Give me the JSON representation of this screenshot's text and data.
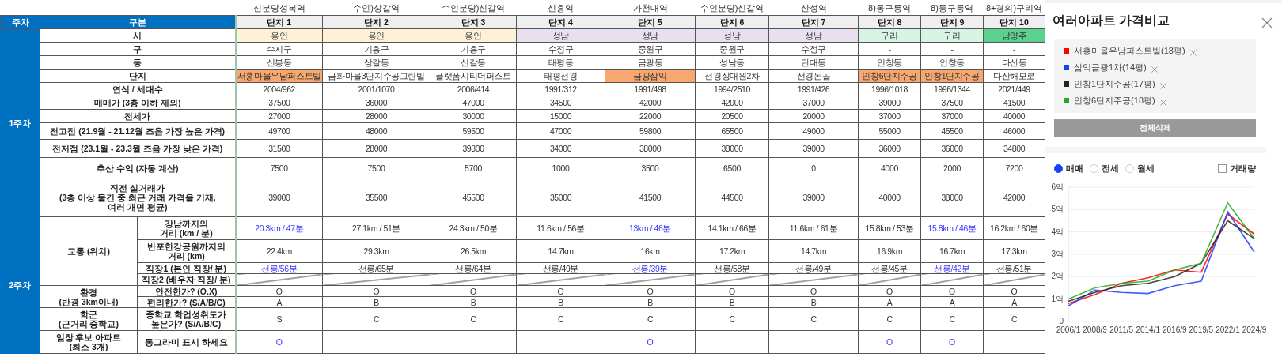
{
  "sheet": {
    "header": {
      "week": "주차",
      "category": "구분"
    },
    "complexes": [
      {
        "station": "신분당성복역",
        "name": "단지 1"
      },
      {
        "station": "수인)상갈역",
        "name": "단지 2"
      },
      {
        "station": "수인분당)신갈역",
        "name": "단지 3"
      },
      {
        "station": "신흥역",
        "name": "단지 4"
      },
      {
        "station": "가천대역",
        "name": "단지 5"
      },
      {
        "station": "수인분당)신갈역",
        "name": "단지 6"
      },
      {
        "station": "산성역",
        "name": "단지 7"
      },
      {
        "station": "8)동구릉역",
        "name": "단지 8"
      },
      {
        "station": "8)동구릉역",
        "name": "단지 9"
      },
      {
        "station": "8+경의)구리역",
        "name": "단지 10"
      }
    ],
    "weeks": [
      {
        "label": "1주차",
        "groups": [
          {
            "label": "시",
            "rows": [
              {
                "cells": [
                  {
                    "text": "용인",
                    "color": "#fdf2d7"
                  },
                  {
                    "text": "용인",
                    "color": "#fdf2d7"
                  },
                  {
                    "text": "용인",
                    "color": "#fdf2d7"
                  },
                  {
                    "text": "성남",
                    "color": "#e8e0f0"
                  },
                  {
                    "text": "성남",
                    "color": "#e8e0f0"
                  },
                  {
                    "text": "성남",
                    "color": "#e8e0f0"
                  },
                  {
                    "text": "성남",
                    "color": "#e8e0f0"
                  },
                  {
                    "text": "구리",
                    "color": "#d7f3e4"
                  },
                  {
                    "text": "구리",
                    "color": "#d7f3e4"
                  },
                  {
                    "text": "남양주",
                    "color": "#5ad18f"
                  }
                ]
              }
            ]
          },
          {
            "label": "구",
            "rows": [
              {
                "cells": [
                  {
                    "text": "수지구"
                  },
                  {
                    "text": "기흥구"
                  },
                  {
                    "text": "기흥구"
                  },
                  {
                    "text": "수정구"
                  },
                  {
                    "text": "중원구"
                  },
                  {
                    "text": "중원구"
                  },
                  {
                    "text": "수정구"
                  },
                  {
                    "text": "-"
                  },
                  {
                    "text": "-"
                  },
                  {
                    "text": "-"
                  }
                ]
              }
            ]
          },
          {
            "label": "동",
            "rows": [
              {
                "cells": [
                  {
                    "text": "신봉동"
                  },
                  {
                    "text": "상갈동"
                  },
                  {
                    "text": "신갈동"
                  },
                  {
                    "text": "태평동"
                  },
                  {
                    "text": "금광동"
                  },
                  {
                    "text": "성남동"
                  },
                  {
                    "text": "단대동"
                  },
                  {
                    "text": "인창동"
                  },
                  {
                    "text": "인창동"
                  },
                  {
                    "text": "다산동"
                  }
                ]
              }
            ]
          },
          {
            "label": "단지",
            "rows": [
              {
                "cells": [
                  {
                    "text": "서홍마을우남퍼스트빌",
                    "highlighted": true
                  },
                  {
                    "text": "금화마을3단지주공그린빌",
                    "highlighted": false
                  },
                  {
                    "text": "플랫폼시티더퍼스트",
                    "highlighted": false
                  },
                  {
                    "text": "태평선경",
                    "highlighted": false
                  },
                  {
                    "text": "금광삼익",
                    "highlighted": true
                  },
                  {
                    "text": "선경상대원2차",
                    "highlighted": false
                  },
                  {
                    "text": "선경논골",
                    "highlighted": false
                  },
                  {
                    "text": "인창6단지주공",
                    "highlighted": true
                  },
                  {
                    "text": "인창1단지주공",
                    "highlighted": true
                  },
                  {
                    "text": "다산해모로",
                    "highlighted": false
                  }
                ]
              }
            ]
          },
          {
            "label": "연식 / 세대수",
            "rows": [
              {
                "cells": [
                  {
                    "text": "2004/962"
                  },
                  {
                    "text": "2001/1070"
                  },
                  {
                    "text": "2006/414"
                  },
                  {
                    "text": "1991/312"
                  },
                  {
                    "text": "1991/498"
                  },
                  {
                    "text": "1994/2510"
                  },
                  {
                    "text": "1991/426"
                  },
                  {
                    "text": "1996/1018"
                  },
                  {
                    "text": "1996/1344"
                  },
                  {
                    "text": "2021/449"
                  }
                ]
              }
            ]
          },
          {
            "label": "매매가 (3층 이하 제외)",
            "rows": [
              {
                "cells": [
                  {
                    "text": "37500"
                  },
                  {
                    "text": "36000"
                  },
                  {
                    "text": "47000"
                  },
                  {
                    "text": "34500"
                  },
                  {
                    "text": "42000"
                  },
                  {
                    "text": "42000"
                  },
                  {
                    "text": "37000"
                  },
                  {
                    "text": "39000"
                  },
                  {
                    "text": "37500"
                  },
                  {
                    "text": "41500"
                  }
                ]
              }
            ]
          },
          {
            "label": "전세가",
            "rows": [
              {
                "cells": [
                  {
                    "text": "27000"
                  },
                  {
                    "text": "28000"
                  },
                  {
                    "text": "30000"
                  },
                  {
                    "text": "15000"
                  },
                  {
                    "text": "22000"
                  },
                  {
                    "text": "20500"
                  },
                  {
                    "text": "20000"
                  },
                  {
                    "text": "37000"
                  },
                  {
                    "text": "37000"
                  },
                  {
                    "text": "40000"
                  }
                ]
              }
            ]
          },
          {
            "label": "전고점 (21.9월 - 21.12월 즈음 가장 높은 가격)",
            "rows": [
              {
                "cells": [
                  {
                    "text": "49700"
                  },
                  {
                    "text": "48000"
                  },
                  {
                    "text": "59500"
                  },
                  {
                    "text": "47000"
                  },
                  {
                    "text": "59800"
                  },
                  {
                    "text": "65500"
                  },
                  {
                    "text": "49000"
                  },
                  {
                    "text": "55000"
                  },
                  {
                    "text": "45500"
                  },
                  {
                    "text": "46000"
                  }
                ]
              }
            ]
          },
          {
            "label": "전저점 (23.1월 - 23.3월 즈음 가장 낮은 가격)",
            "rows": [
              {
                "cells": [
                  {
                    "text": "31500"
                  },
                  {
                    "text": "28000"
                  },
                  {
                    "text": "39800"
                  },
                  {
                    "text": "34000"
                  },
                  {
                    "text": "38000"
                  },
                  {
                    "text": "38000"
                  },
                  {
                    "text": "39000"
                  },
                  {
                    "text": "36000"
                  },
                  {
                    "text": "36000"
                  },
                  {
                    "text": "34800"
                  }
                ]
              }
            ]
          },
          {
            "label": "추산 수익 (자동 계산)",
            "rows": [
              {
                "cells": [
                  {
                    "text": "7500"
                  },
                  {
                    "text": "7500"
                  },
                  {
                    "text": "5700"
                  },
                  {
                    "text": "1000"
                  },
                  {
                    "text": "3500"
                  },
                  {
                    "text": "6500"
                  },
                  {
                    "text": "0"
                  },
                  {
                    "text": "4000"
                  },
                  {
                    "text": "2000"
                  },
                  {
                    "text": "7200"
                  }
                ]
              }
            ]
          },
          {
            "label": "직전 실거래가\n(3층 이상 물건 중 최근 거래 가격을 기재,\n여러 개면 평균)",
            "rows": [
              {
                "cells": [
                  {
                    "text": "39000"
                  },
                  {
                    "text": "35500"
                  },
                  {
                    "text": "45500"
                  },
                  {
                    "text": "35000"
                  },
                  {
                    "text": "41500"
                  },
                  {
                    "text": "44500"
                  },
                  {
                    "text": "39000"
                  },
                  {
                    "text": "40000"
                  },
                  {
                    "text": "38000"
                  },
                  {
                    "text": "42000"
                  }
                ]
              }
            ]
          }
        ]
      },
      {
        "label": "2주차",
        "groups": [
          {
            "label": "교통 (위치)",
            "rows": [
              {
                "label": "강남까지의\n거리 (km / 분)",
                "cells": [
                  {
                    "text": "20.3km / 47분",
                    "emphasized": true
                  },
                  {
                    "text": "27.1km / 51분",
                    "emphasized": false
                  },
                  {
                    "text": "24.3km / 50분",
                    "emphasized": false
                  },
                  {
                    "text": "11.6km / 56분",
                    "emphasized": false
                  },
                  {
                    "text": "13km / 46분",
                    "emphasized": true
                  },
                  {
                    "text": "14.1km / 66분",
                    "emphasized": false
                  },
                  {
                    "text": "11.6km / 61분",
                    "emphasized": false
                  },
                  {
                    "text": "15.8km / 53분",
                    "emphasized": false
                  },
                  {
                    "text": "15.8km / 46분",
                    "emphasized": true
                  },
                  {
                    "text": "16.2km / 60분",
                    "emphasized": false
                  }
                ]
              },
              {
                "label": "반포한강공원까지의\n거리 (km)",
                "cells": [
                  {
                    "text": "22.4km"
                  },
                  {
                    "text": "29.3km"
                  },
                  {
                    "text": "26.5km"
                  },
                  {
                    "text": "14.7km"
                  },
                  {
                    "text": "16km"
                  },
                  {
                    "text": "17.2km"
                  },
                  {
                    "text": "14.7km"
                  },
                  {
                    "text": "16.9km"
                  },
                  {
                    "text": "16.7km"
                  },
                  {
                    "text": "17.3km"
                  }
                ]
              },
              {
                "label": "직장1 (본인 직장/ 분)",
                "cells": [
                  {
                    "text": "선릉/56분",
                    "emphasized": true
                  },
                  {
                    "text": "선릉/65분",
                    "emphasized": false
                  },
                  {
                    "text": "선릉/64분",
                    "emphasized": false
                  },
                  {
                    "text": "선릉/49분",
                    "emphasized": false
                  },
                  {
                    "text": "선릉/39분",
                    "emphasized": true
                  },
                  {
                    "text": "선릉/58분",
                    "emphasized": false
                  },
                  {
                    "text": "선릉/49분",
                    "emphasized": false
                  },
                  {
                    "text": "선릉/45분",
                    "emphasized": false
                  },
                  {
                    "text": "선릉/42분",
                    "emphasized": true
                  },
                  {
                    "text": "선릉/51분",
                    "emphasized": false
                  }
                ]
              },
              {
                "label": "직장2 (배우자 직장/ 분)",
                "kind": "struck"
              }
            ]
          },
          {
            "label": "환경\n(반경 3km이내)",
            "rows": [
              {
                "label": "안전한가? (O.X)",
                "cells": [
                  {
                    "text": "O"
                  },
                  {
                    "text": "O"
                  },
                  {
                    "text": "O"
                  },
                  {
                    "text": "O"
                  },
                  {
                    "text": "O"
                  },
                  {
                    "text": "O"
                  },
                  {
                    "text": "O"
                  },
                  {
                    "text": "O"
                  },
                  {
                    "text": "O"
                  },
                  {
                    "text": "O"
                  }
                ]
              },
              {
                "label": "편리한가? (S/A/B/C)",
                "cells": [
                  {
                    "text": "A"
                  },
                  {
                    "text": "B"
                  },
                  {
                    "text": "B"
                  },
                  {
                    "text": "B"
                  },
                  {
                    "text": "B"
                  },
                  {
                    "text": "B"
                  },
                  {
                    "text": "B"
                  },
                  {
                    "text": "A"
                  },
                  {
                    "text": "A"
                  },
                  {
                    "text": "A"
                  }
                ]
              }
            ]
          },
          {
            "label": "학군\n(근거리 중학교)",
            "rows": [
              {
                "label": "중학교 학업성취도가\n높은가? (S/A/B/C)",
                "cells": [
                  {
                    "text": "S"
                  },
                  {
                    "text": "C"
                  },
                  {
                    "text": "C"
                  },
                  {
                    "text": "C"
                  },
                  {
                    "text": "C"
                  },
                  {
                    "text": "C"
                  },
                  {
                    "text": "C"
                  },
                  {
                    "text": "C"
                  },
                  {
                    "text": "C"
                  },
                  {
                    "text": "C"
                  }
                ]
              }
            ]
          },
          {
            "label": "임장 후보 아파트\n(최소 3개)",
            "rows": [
              {
                "label": "동그라미 표시 하세요",
                "cells": [
                  {
                    "text": "O",
                    "emphasized": true
                  },
                  null,
                  null,
                  null,
                  {
                    "text": "O",
                    "emphasized": true
                  },
                  null,
                  null,
                  {
                    "text": "O",
                    "emphasized": true
                  },
                  {
                    "text": "O",
                    "emphasized": true
                  },
                  null
                ]
              }
            ]
          }
        ]
      }
    ]
  },
  "panel": {
    "title": "여러아파트 가격비교",
    "clear_button": "전체삭제",
    "price_types": [
      {
        "label": "매매",
        "selected": true
      },
      {
        "label": "전세",
        "selected": false
      },
      {
        "label": "월세",
        "selected": false
      }
    ],
    "volume": {
      "label": "거래량",
      "checked": false
    },
    "chart_data": {
      "type": "line",
      "grid": true,
      "categories": [
        "2006/1",
        "2008/9",
        "2011/5",
        "2014/1",
        "2016/9",
        "2019/5",
        "2022/1",
        "2024/9"
      ],
      "yticks": [
        {
          "value": 0,
          "label": "0"
        },
        {
          "value": 1,
          "label": "1억"
        },
        {
          "value": 2,
          "label": "2억"
        },
        {
          "value": 3,
          "label": "3억"
        },
        {
          "value": 4,
          "label": "4억"
        },
        {
          "value": 5,
          "label": "5억"
        },
        {
          "value": 6,
          "label": "6억"
        }
      ],
      "ylim": [
        0,
        6
      ],
      "series": [
        {
          "name": "서홍마을우남퍼스트빌(18평)",
          "color": "#ff0000",
          "values": [
            0.8,
            1.2,
            1.7,
            1.95,
            2.3,
            2.2,
            4.8,
            3.9
          ]
        },
        {
          "name": "삼익금광1차(14평)",
          "color": "#1f3cff",
          "values": [
            0.7,
            1.4,
            1.3,
            1.25,
            1.6,
            1.8,
            4.9,
            3.1
          ]
        },
        {
          "name": "인창1단지주공(17평)",
          "color": "#222222",
          "values": [
            0.9,
            1.3,
            1.6,
            1.7,
            2.0,
            2.6,
            4.5,
            3.7
          ]
        },
        {
          "name": "인창6단지주공(18평)",
          "color": "#22aa22",
          "values": [
            1.0,
            1.5,
            1.7,
            1.8,
            2.3,
            2.6,
            5.3,
            3.7
          ]
        }
      ]
    }
  }
}
